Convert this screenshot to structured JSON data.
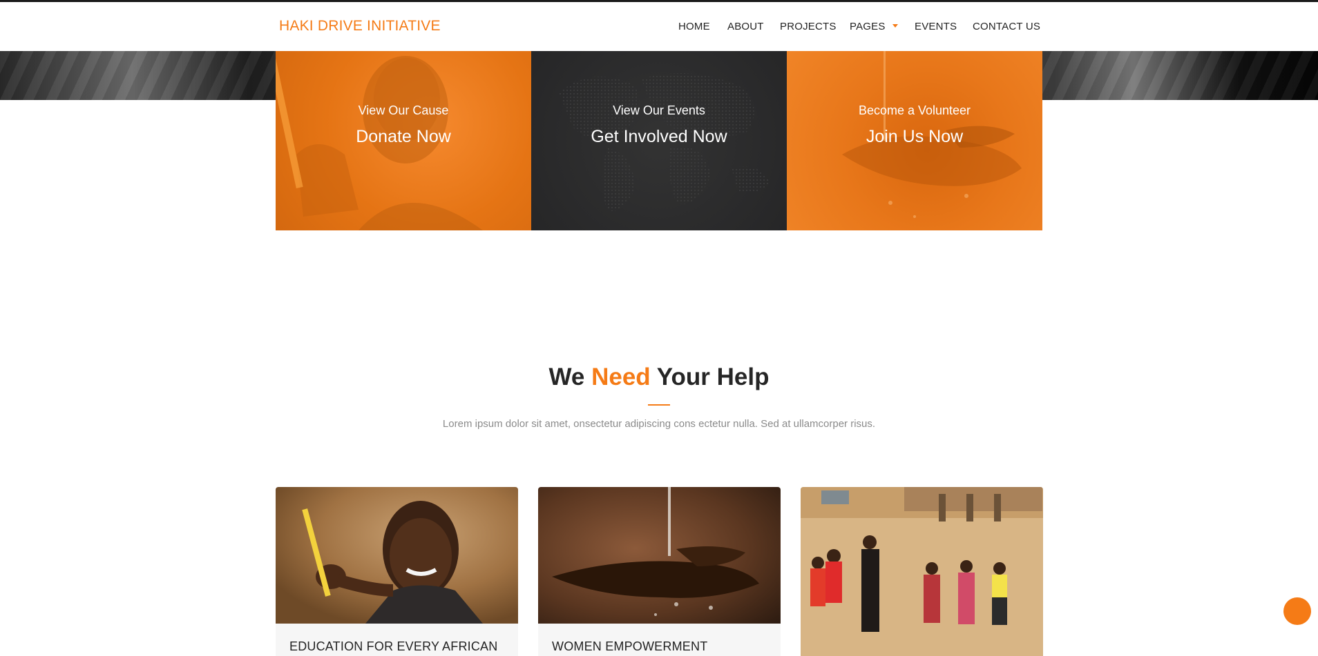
{
  "brand": {
    "name": "HAKI DRIVE INITIATIVE",
    "color": "#f57b16"
  },
  "nav": {
    "items": [
      {
        "label": "HOME"
      },
      {
        "label": "ABOUT"
      },
      {
        "label": "PROJECTS"
      },
      {
        "label": "PAGES",
        "has_dropdown": true
      },
      {
        "label": "EVENTS"
      },
      {
        "label": "CONTACT US"
      }
    ]
  },
  "cta_boxes": [
    {
      "subtitle": "View Our Cause",
      "title": "Donate Now"
    },
    {
      "subtitle": "View Our Events",
      "title": "Get Involved Now"
    },
    {
      "subtitle": "Become a Volunteer",
      "title": "Join Us Now"
    }
  ],
  "help_section": {
    "title_before": "We ",
    "title_highlight": "Need",
    "title_after": " Your Help",
    "subtitle": "Lorem ipsum dolor sit amet, onsectetur adipiscing cons ectetur nulla. Sed at ullamcorper risus."
  },
  "cards": [
    {
      "caption": "EDUCATION FOR EVERY AFRICAN",
      "image": "girl-holding-pencil-photo"
    },
    {
      "caption": "WOMEN EMPOWERMENT",
      "image": "water-in-hands-photo"
    },
    {
      "caption": "",
      "image": "children-dancing-photo"
    }
  ],
  "colors": {
    "accent": "#f57b16",
    "dark_box": "#2a2a2b",
    "heading": "#262626",
    "muted": "#8a8a8a"
  },
  "icons": {
    "dropdown": "caret-down-icon",
    "scroll_top": "scroll-to-top-icon"
  }
}
